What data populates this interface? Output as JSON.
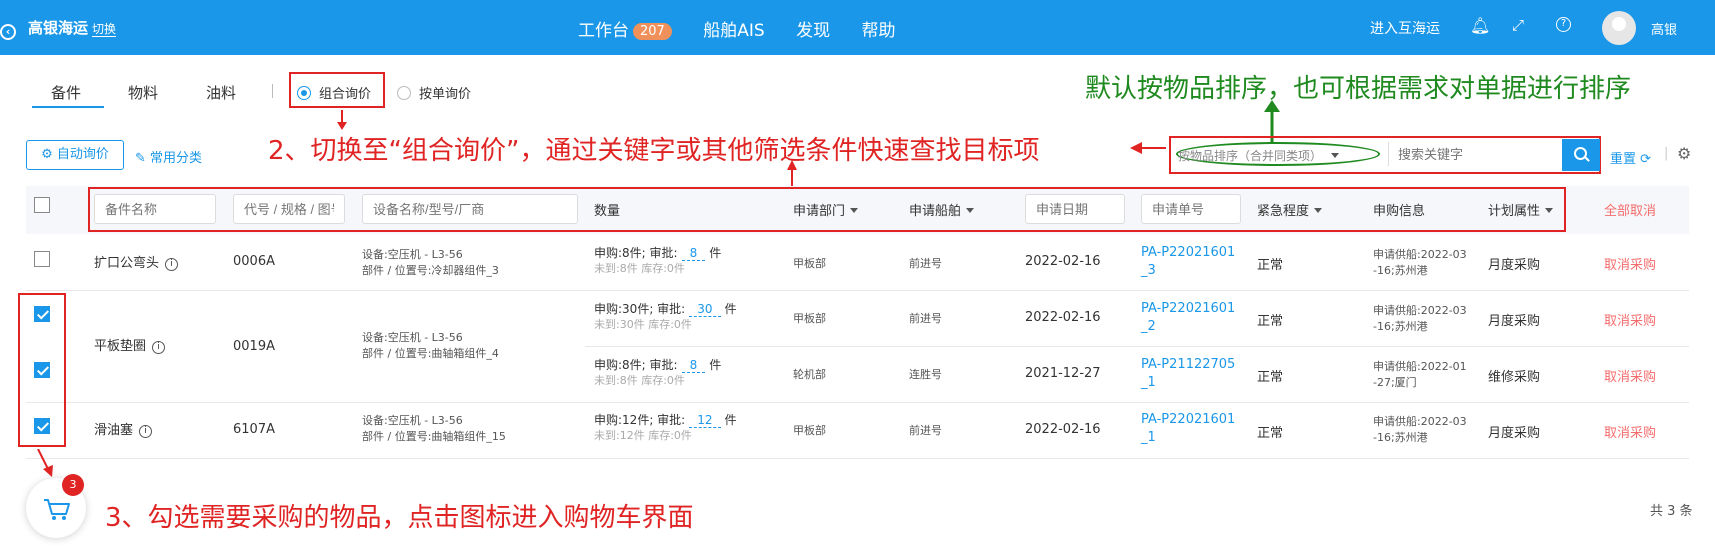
{
  "topbar": {
    "logo": "高银海运",
    "switch": "切换",
    "nav": {
      "workbench": "工作台",
      "workbench_badge": "207",
      "ais": "船舶AIS",
      "discover": "发现",
      "help": "帮助"
    },
    "enter": "进入互海运",
    "user": "高银"
  },
  "tabs": [
    "备件",
    "物料",
    "油料"
  ],
  "radios": {
    "combo": "组合询价",
    "single": "按单询价"
  },
  "annotations": {
    "a1": "默认按物品排序，也可根据需求对单据进行排序",
    "a2": "2、切换至“组合询价”，通过关键字或其他筛选条件快速查找目标项",
    "a3": "3、勾选需要采购的物品，点击图标进入购物车界面"
  },
  "toolbar": {
    "auto": "自动询价",
    "category": "常用分类",
    "sort": "按物品排序（合并同类项）",
    "search_placeholder": "搜索关键字",
    "reset": "重置"
  },
  "header": {
    "name": "备件名称",
    "code": "代号 / 规格 / 图号",
    "equip": "设备名称/型号/厂商",
    "qty": "数量",
    "dept": "申请部门",
    "ship": "申请船舶",
    "date": "申请日期",
    "order": "申请单号",
    "urgency": "紧急程度",
    "buyinfo": "申购信息",
    "plan": "计划属性",
    "cancel_all": "全部取消"
  },
  "rows": [
    {
      "name": "扩口公弯头",
      "code": "0006A",
      "equip1": "设备:空压机 - L3-56",
      "equip2": "部件 / 位置号:冷却器组件_3",
      "qtyline": "申购:8件; 审批:",
      "approve": "8",
      "unit": "件",
      "stock": "未到:8件 库存:0件",
      "dept": "甲板部",
      "ship": "前进号",
      "date": "2022-02-16",
      "order1": "PA-P22021601",
      "order2": "_3",
      "urgency": "正常",
      "info1": "申请供船:2022-03",
      "info2": "-16;苏州港",
      "plan": "月度采购",
      "action": "取消采购"
    },
    {
      "name": "平板垫圈",
      "code": "0019A",
      "equip1": "设备:空压机 - L3-56",
      "equip2": "部件 / 位置号:曲轴箱组件_4",
      "qtyline": "申购:30件; 审批:",
      "approve": "30",
      "unit": "件",
      "stock": "未到:30件 库存:0件",
      "dept": "甲板部",
      "ship": "前进号",
      "date": "2022-02-16",
      "order1": "PA-P22021601",
      "order2": "_2",
      "urgency": "正常",
      "info1": "申请供船:2022-03",
      "info2": "-16;苏州港",
      "plan": "月度采购",
      "action": "取消采购"
    },
    {
      "qtyline": "申购:8件; 审批:",
      "approve": "8",
      "unit": "件",
      "stock": "未到:8件 库存:0件",
      "dept": "轮机部",
      "ship": "连胜号",
      "date": "2021-12-27",
      "order1": "PA-P21122705",
      "order2": "_1",
      "urgency": "正常",
      "info1": "申请供船:2022-01",
      "info2": "-27;厦门",
      "plan": "维修采购",
      "action": "取消采购"
    },
    {
      "name": "滑油塞",
      "code": "6107A",
      "equip1": "设备:空压机 - L3-56",
      "equip2": "部件 / 位置号:曲轴箱组件_15",
      "qtyline": "申购:12件; 审批:",
      "approve": "12",
      "unit": "件",
      "stock": "未到:12件 库存:0件",
      "dept": "甲板部",
      "ship": "前进号",
      "date": "2022-02-16",
      "order1": "PA-P22021601",
      "order2": "_1",
      "urgency": "正常",
      "info1": "申请供船:2022-03",
      "info2": "-16;苏州港",
      "plan": "月度采购",
      "action": "取消采购"
    }
  ],
  "cart_count": "3",
  "total": "共 3 条",
  "colors": {
    "primary": "#1a97e8",
    "annotation_red": "#e02424",
    "annotation_green": "#1f8a1f"
  }
}
